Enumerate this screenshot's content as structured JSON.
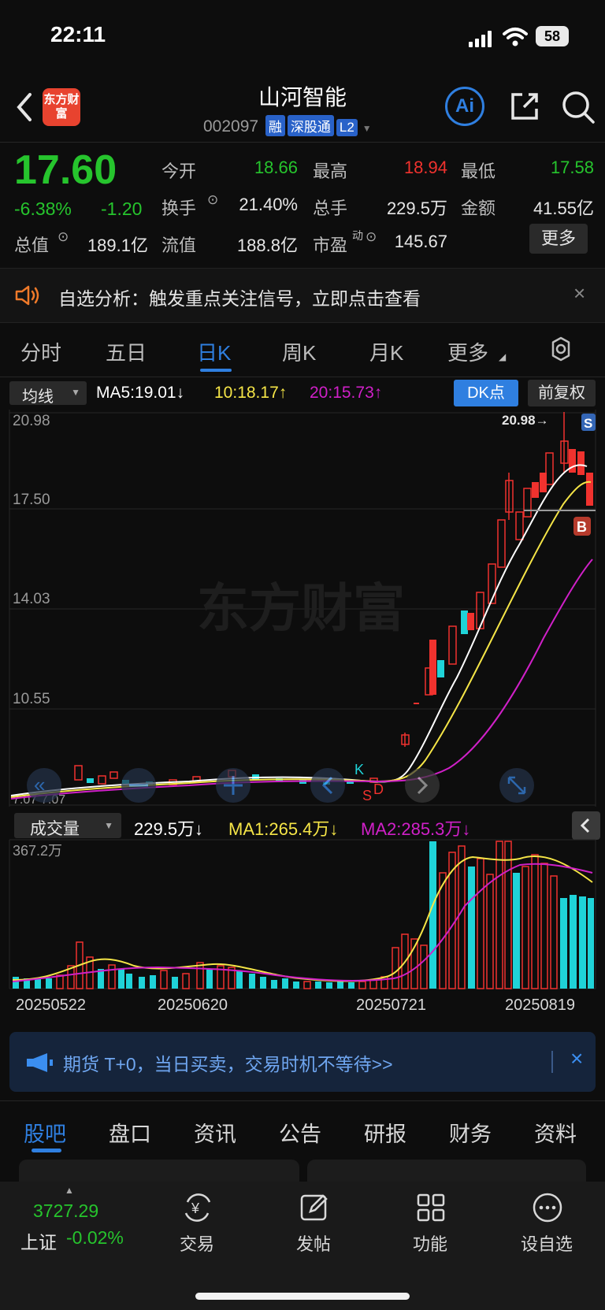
{
  "status": {
    "time": "22:11",
    "battery": "58"
  },
  "header": {
    "logo_text": "东方财富",
    "stock_name": "山河智能",
    "code": "002097",
    "tags": [
      "融",
      "深股通",
      "L2"
    ],
    "ai_label": "Ai"
  },
  "quote": {
    "price": "17.60",
    "change_pct": "-6.38%",
    "change": "-1.20",
    "open_label": "今开",
    "open": "18.66",
    "high_label": "最高",
    "high": "18.94",
    "low_label": "最低",
    "low": "17.58",
    "turnover_label": "换手",
    "turnover": "21.40%",
    "volume_label": "总手",
    "volume": "229.5万",
    "amount_label": "金额",
    "amount": "41.55亿",
    "mcap_label": "总值",
    "mcap": "189.1亿",
    "float_label": "流值",
    "float": "188.8亿",
    "pe_label": "市盈",
    "pe_sup": "动",
    "pe": "145.67",
    "more": "更多"
  },
  "notice": {
    "text": "自选分析：触发重点关注信号，立即点击查看"
  },
  "kline_tabs": [
    "分时",
    "五日",
    "日K",
    "周K",
    "月K",
    "更多"
  ],
  "kline_active": "日K",
  "indicators": {
    "ma_select": "均线",
    "ma5": "MA5:19.01↓",
    "ma10": "10:18.17↑",
    "ma20": "20:15.73↑",
    "dk": "DK点",
    "fq": "前复权"
  },
  "price_axis": {
    "labels": [
      "20.98",
      "17.50",
      "14.03",
      "10.55",
      "7.07"
    ],
    "high_marker": "20.98→",
    "low_marker": "7.07"
  },
  "watermark": "东方财富",
  "signals": {
    "s": "S",
    "b": "B",
    "k": "K",
    "d": "D"
  },
  "volume_panel": {
    "select": "成交量",
    "vol": "229.5万↓",
    "ma1": "MA1:265.4万↓",
    "ma2": "MA2:285.3万↓",
    "max_label": "367.2万"
  },
  "date_axis": [
    "20250522",
    "20250620",
    "20250721",
    "20250819"
  ],
  "ad": {
    "text": "期货 T+0，当日买卖，交易时机不等待>>"
  },
  "bottom_tabs": [
    "股吧",
    "盘口",
    "资讯",
    "公告",
    "研报",
    "财务",
    "资料"
  ],
  "nav": {
    "index_value": "3727.29",
    "index_name": "上证",
    "index_change": "-0.02%",
    "items": [
      "交易",
      "发帖",
      "功能",
      "设自选"
    ]
  },
  "colors": {
    "up": "#f0322e",
    "down": "#26c42d",
    "vol_down": "#1fd3d8",
    "ma5": "#ffffff",
    "ma10": "#f5e547",
    "ma20": "#d020c8",
    "accent": "#2f7fe0"
  }
}
